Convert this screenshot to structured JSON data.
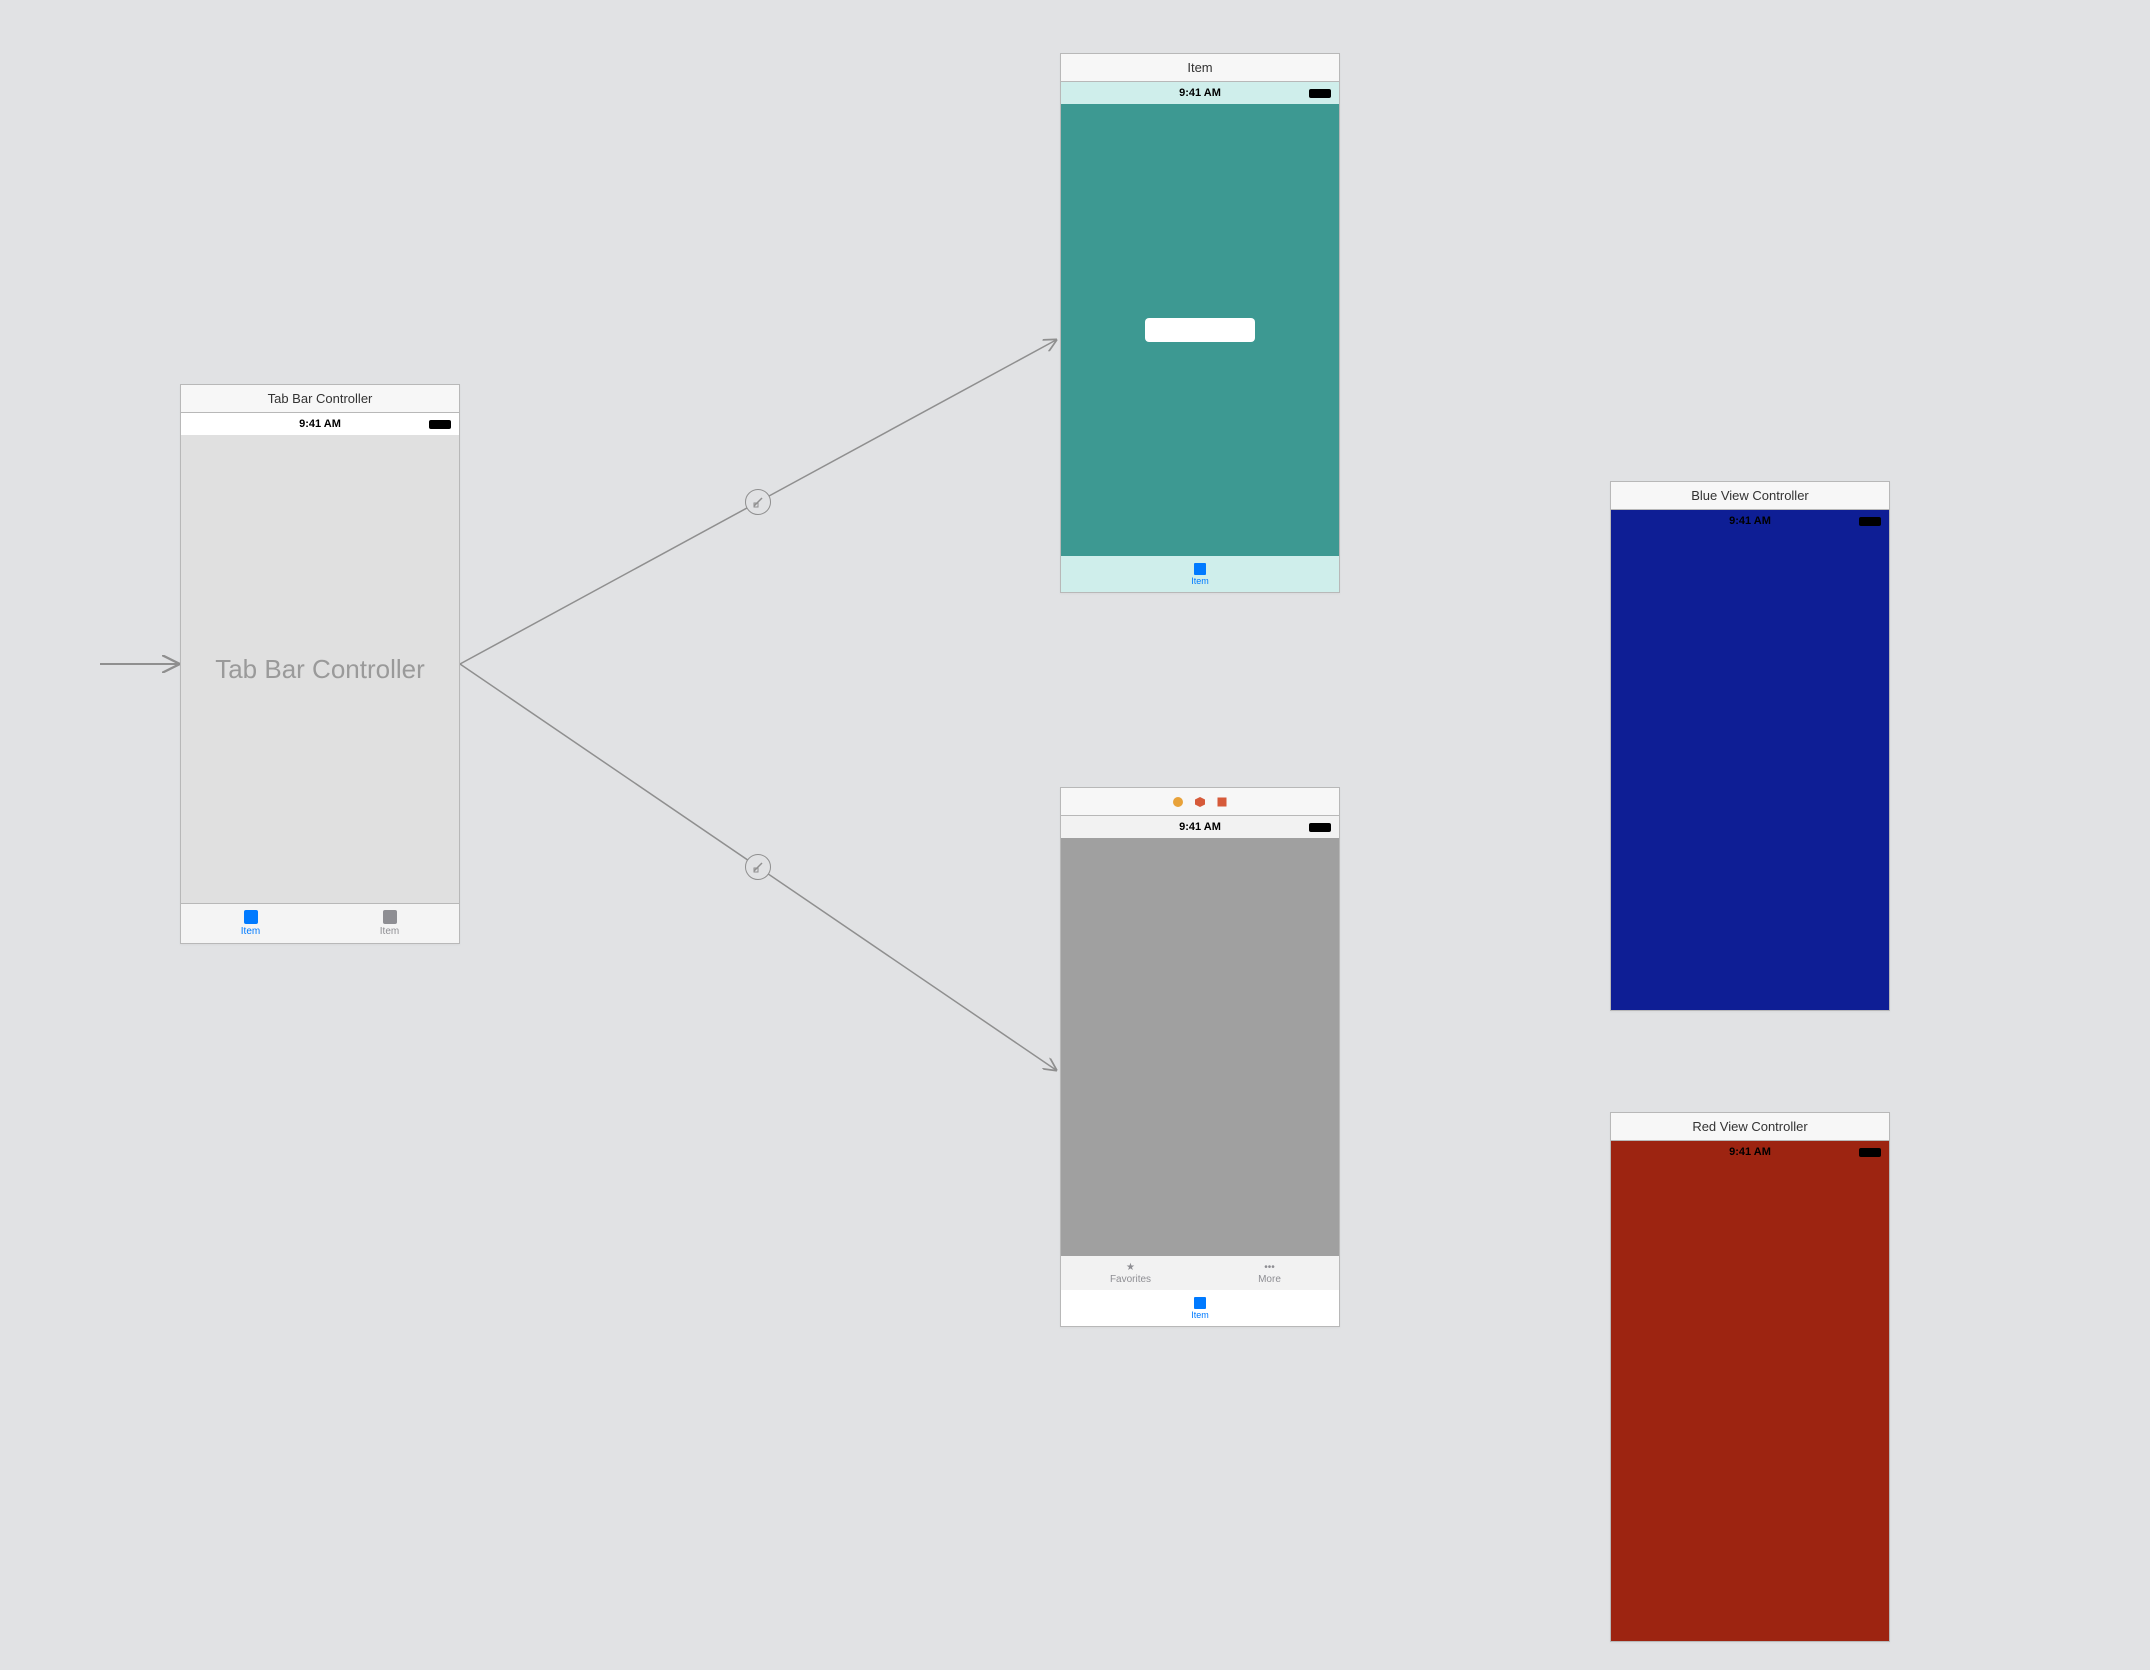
{
  "statusBar": {
    "time": "9:41 AM"
  },
  "scenes": {
    "tabBarController": {
      "title": "Tab Bar Controller",
      "placeholder": "Tab Bar Controller",
      "tabs": [
        {
          "label": "Item",
          "active": true
        },
        {
          "label": "Item",
          "active": false
        }
      ]
    },
    "item": {
      "title": "Item",
      "bodyColor": "#3d9992",
      "tabLabel": "Item"
    },
    "gray": {
      "titleIcons": [
        "circle",
        "hexagon",
        "square"
      ],
      "bodyColor": "#a0a0a0",
      "innerTabs": [
        {
          "label": "Favorites",
          "icon": "star"
        },
        {
          "label": "More",
          "icon": "more"
        }
      ],
      "tabLabel": "Item"
    },
    "blue": {
      "title": "Blue View Controller",
      "bodyColor": "#0e1e95"
    },
    "red": {
      "title": "Red View Controller",
      "bodyColor": "#9d2411"
    }
  },
  "segues": [
    {
      "from": "entry",
      "to": "tabBarController",
      "kind": "initial"
    },
    {
      "from": "tabBarController",
      "to": "item",
      "kind": "relationship"
    },
    {
      "from": "tabBarController",
      "to": "gray",
      "kind": "relationship"
    }
  ]
}
